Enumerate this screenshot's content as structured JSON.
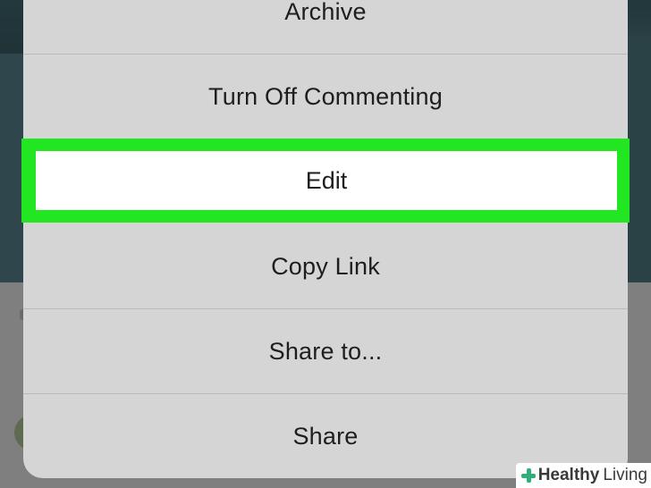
{
  "menu": {
    "archive": "Archive",
    "turn_off_commenting": "Turn Off Commenting",
    "edit": "Edit",
    "copy_link": "Copy Link",
    "share_to": "Share to...",
    "share": "Share"
  },
  "watermark": {
    "brand": "Healthy",
    "brand_suffix": "Living"
  },
  "colors": {
    "highlight": "#22e622",
    "sheet": "#d5d5d5"
  }
}
